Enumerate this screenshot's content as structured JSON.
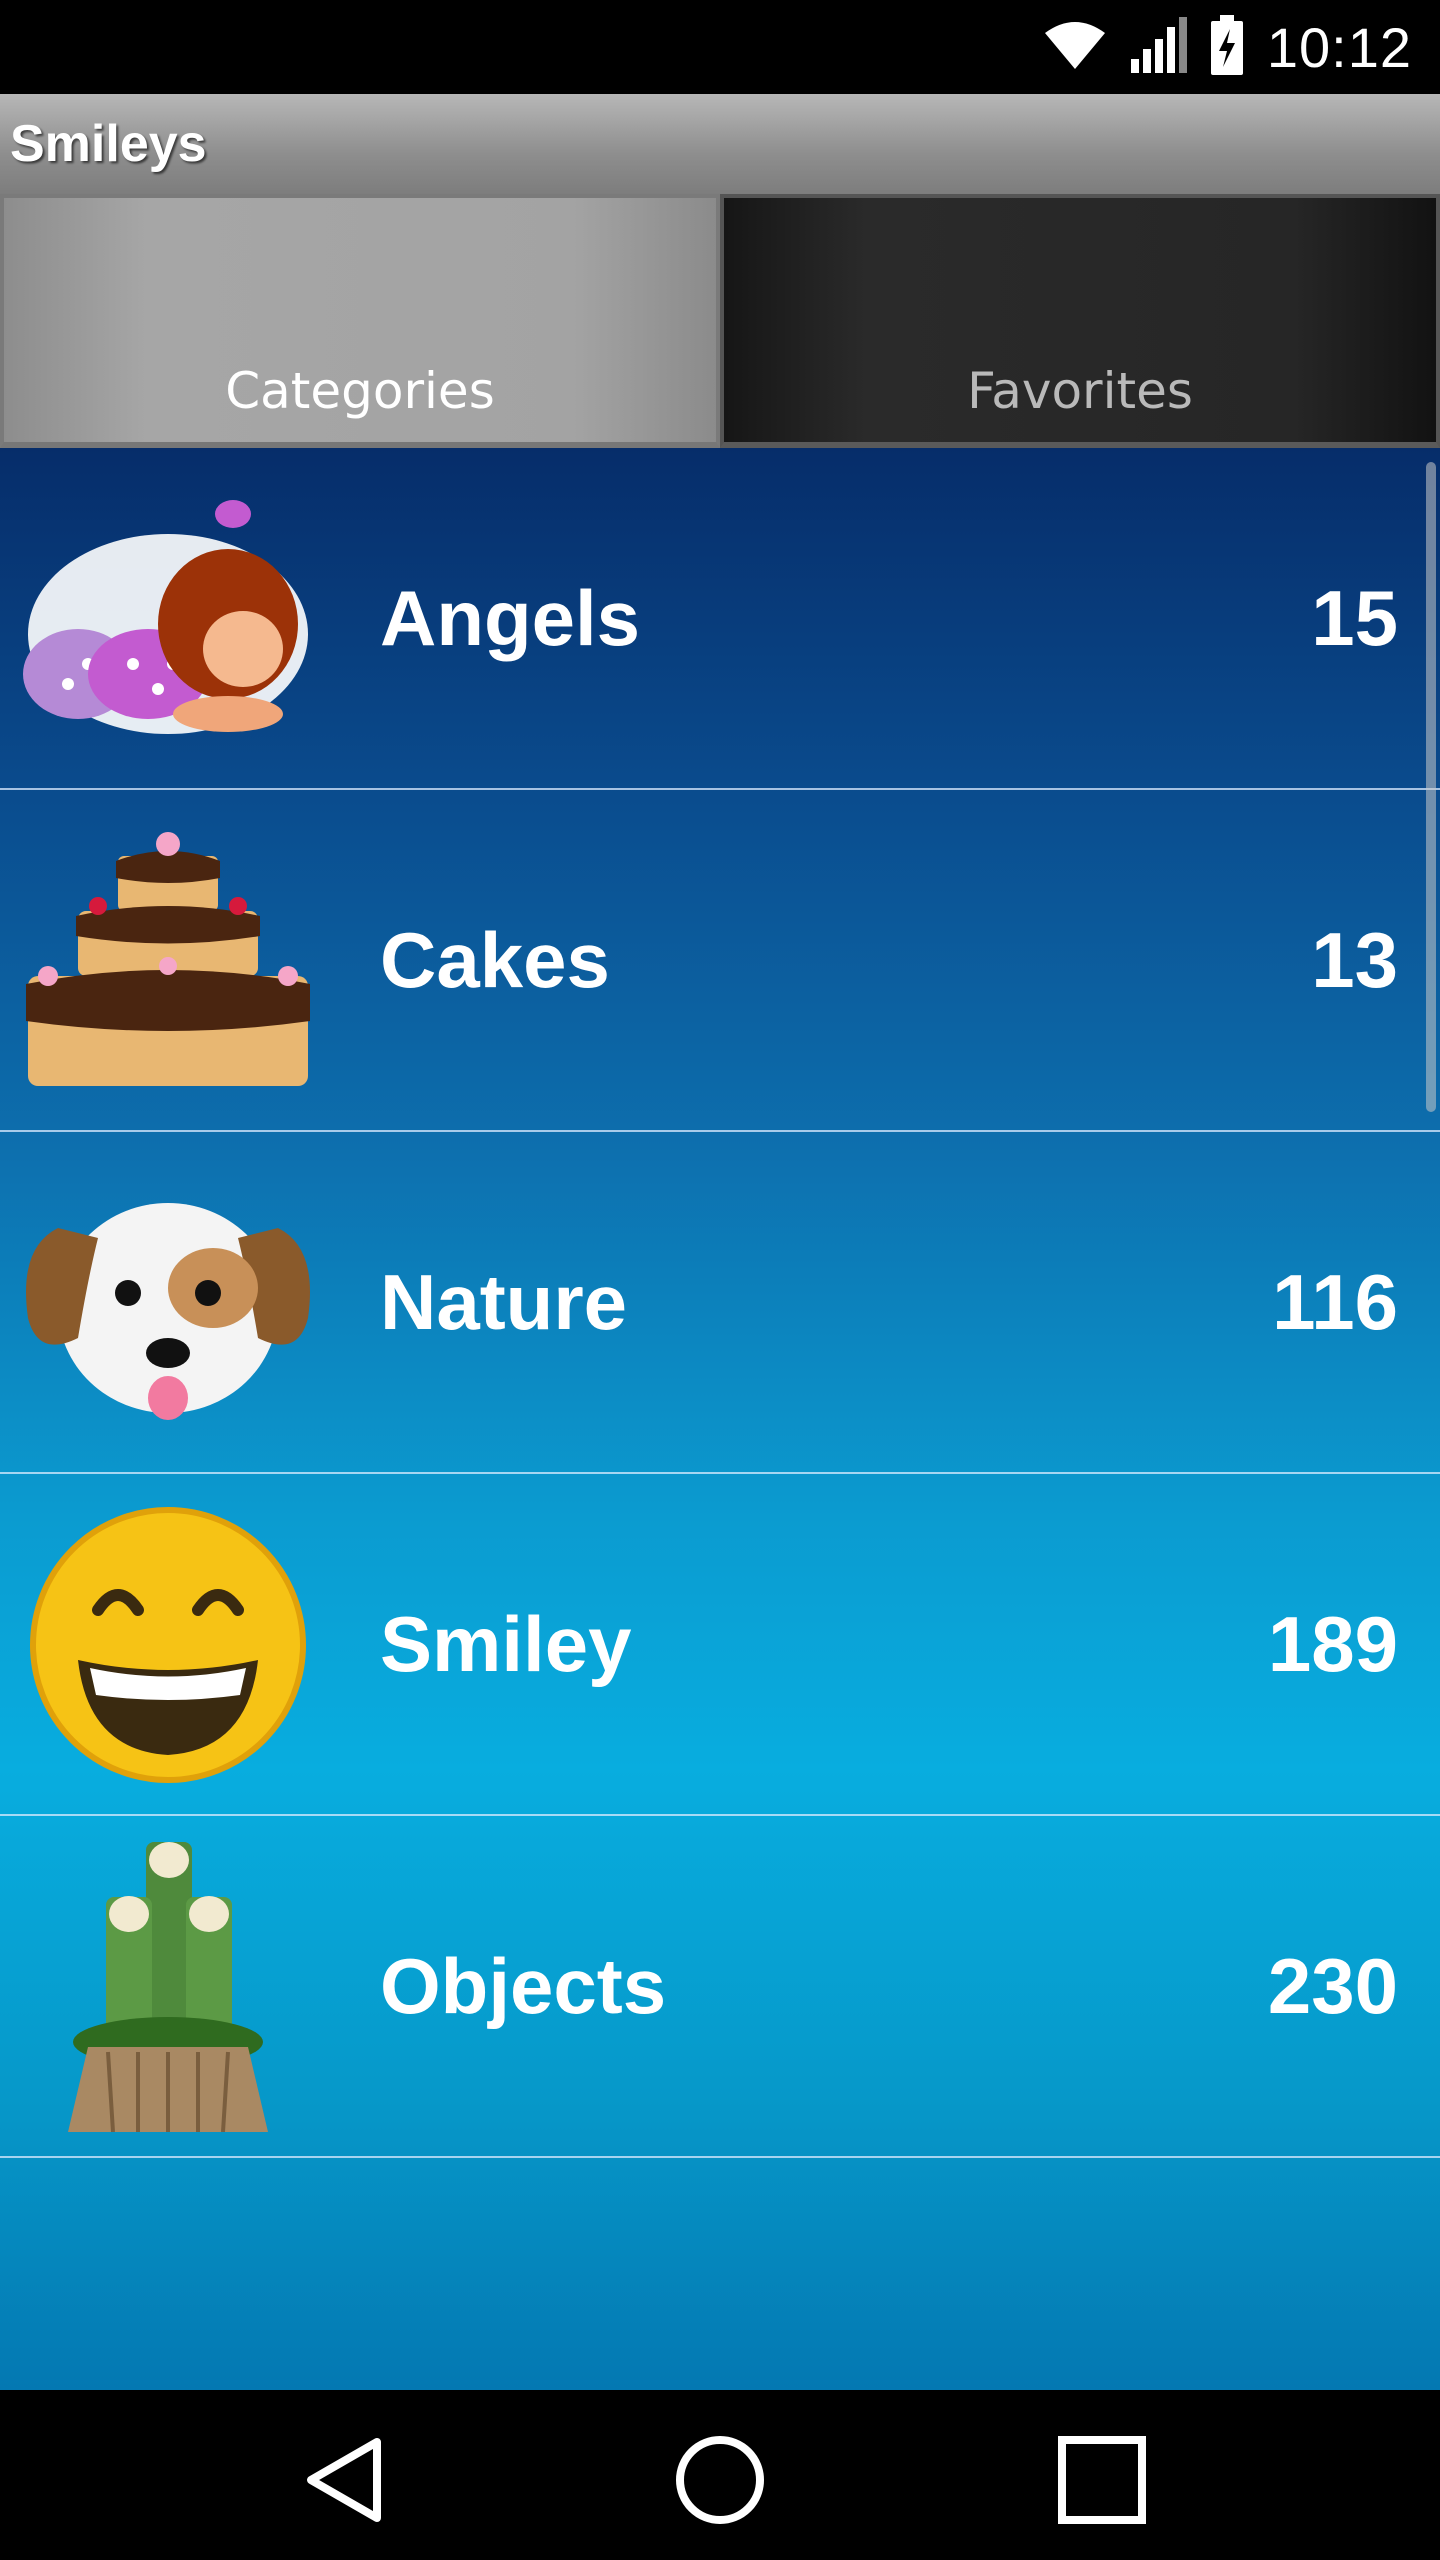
{
  "status_bar": {
    "time": "10:12",
    "icons": [
      "wifi-icon",
      "cell-signal-icon",
      "battery-charging-icon"
    ]
  },
  "action_bar": {
    "title": "Smileys"
  },
  "tabs": [
    {
      "label": "Categories",
      "selected": true
    },
    {
      "label": "Favorites",
      "selected": false
    }
  ],
  "categories": [
    {
      "label": "Angels",
      "count": "15",
      "icon": "angel-girl-icon"
    },
    {
      "label": "Cakes",
      "count": "13",
      "icon": "cake-icon"
    },
    {
      "label": "Nature",
      "count": "116",
      "icon": "dog-face-icon"
    },
    {
      "label": "Smiley",
      "count": "189",
      "icon": "grinning-face-icon"
    },
    {
      "label": "Objects",
      "count": "230",
      "icon": "bamboo-decoration-icon"
    }
  ],
  "nav_bar": {
    "buttons": [
      "back-icon",
      "home-icon",
      "recents-icon"
    ]
  },
  "colors": {
    "list_top": "#062d6a",
    "list_mid": "#08addf",
    "tab_active": "#a6a6a6",
    "tab_inactive": "#262626"
  }
}
